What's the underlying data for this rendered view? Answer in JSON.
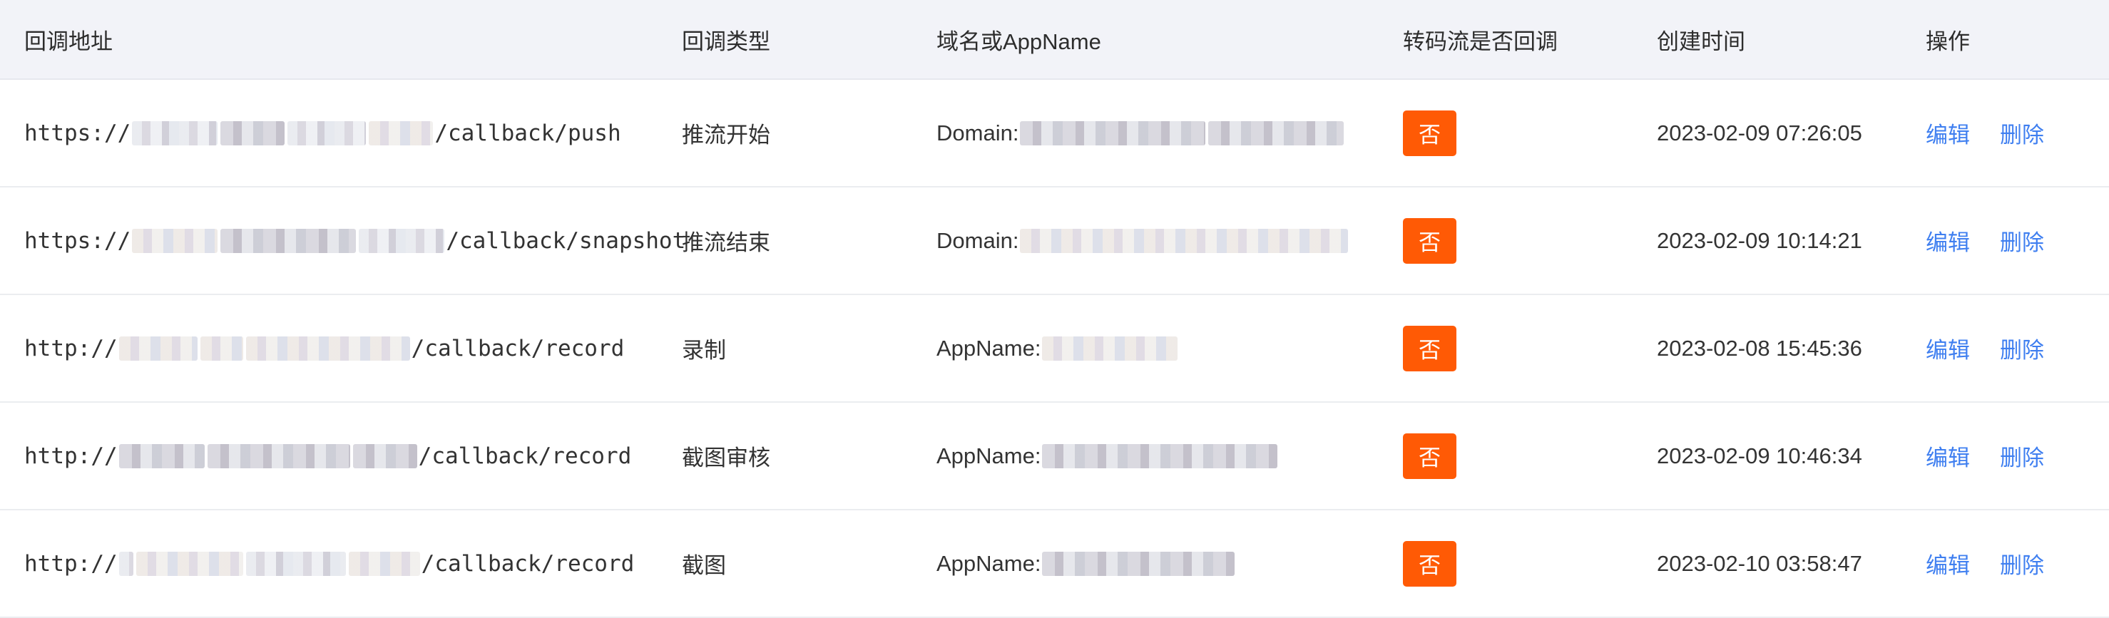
{
  "columns": {
    "url": "回调地址",
    "type": "回调类型",
    "domain": "域名或AppName",
    "transcode": "转码流是否回调",
    "created": "创建时间",
    "ops": "操作"
  },
  "rows": [
    {
      "url_prefix": "https://",
      "url_suffix": "/callback/push",
      "type": "推流开始",
      "domain_label": "Domain:",
      "transcode": "否",
      "created": "2023-02-09 07:26:05",
      "edit": "编辑",
      "delete": "删除"
    },
    {
      "url_prefix": "https://",
      "url_suffix": "/callback/snapshot",
      "type": "推流结束",
      "domain_label": "Domain:",
      "transcode": "否",
      "created": "2023-02-09 10:14:21",
      "edit": "编辑",
      "delete": "删除"
    },
    {
      "url_prefix": "http://",
      "url_suffix": "/callback/record",
      "type": "录制",
      "domain_label": "AppName:",
      "transcode": "否",
      "created": "2023-02-08 15:45:36",
      "edit": "编辑",
      "delete": "删除"
    },
    {
      "url_prefix": "http://",
      "url_suffix": "/callback/record",
      "type": "截图审核",
      "domain_label": "AppName:",
      "transcode": "否",
      "created": "2023-02-09 10:46:34",
      "edit": "编辑",
      "delete": "删除"
    },
    {
      "url_prefix": "http://",
      "url_suffix": "/callback/record",
      "type": "截图",
      "domain_label": "AppName:",
      "transcode": "否",
      "created": "2023-02-10 03:58:47",
      "edit": "编辑",
      "delete": "删除"
    }
  ],
  "colors": {
    "header_bg": "#f2f3f8",
    "badge": "#ff5a05",
    "link": "#3f7ff0"
  }
}
